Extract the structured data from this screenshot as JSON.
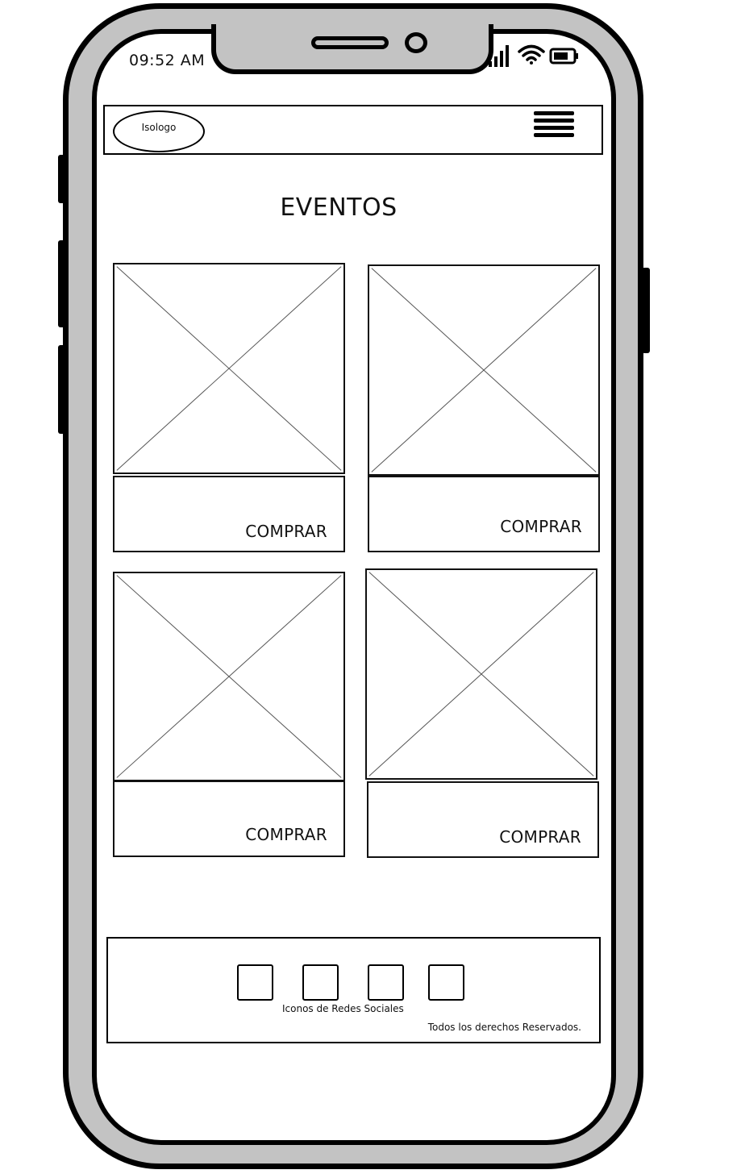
{
  "status_bar": {
    "time": "09:52 AM",
    "icons": [
      "signal-icon",
      "wifi-icon",
      "battery-icon"
    ]
  },
  "header": {
    "logo_label": "Isologo",
    "menu_icon": "hamburger-menu-icon"
  },
  "page_title": "EVENTOS",
  "events": [
    {
      "image": "image-placeholder",
      "button_label": "COMPRAR"
    },
    {
      "image": "image-placeholder",
      "button_label": "COMPRAR"
    },
    {
      "image": "image-placeholder",
      "button_label": "COMPRAR"
    },
    {
      "image": "image-placeholder",
      "button_label": "COMPRAR"
    }
  ],
  "footer": {
    "social_icons": [
      "social-icon",
      "social-icon",
      "social-icon",
      "social-icon"
    ],
    "social_caption": "Iconos de Redes Sociales",
    "copyright": "Todos los derechos Reservados."
  },
  "colors": {
    "frame": "#c3c3c3",
    "outline": "#000000",
    "placeholder_cross": "#555555",
    "screen": "#ffffff"
  }
}
